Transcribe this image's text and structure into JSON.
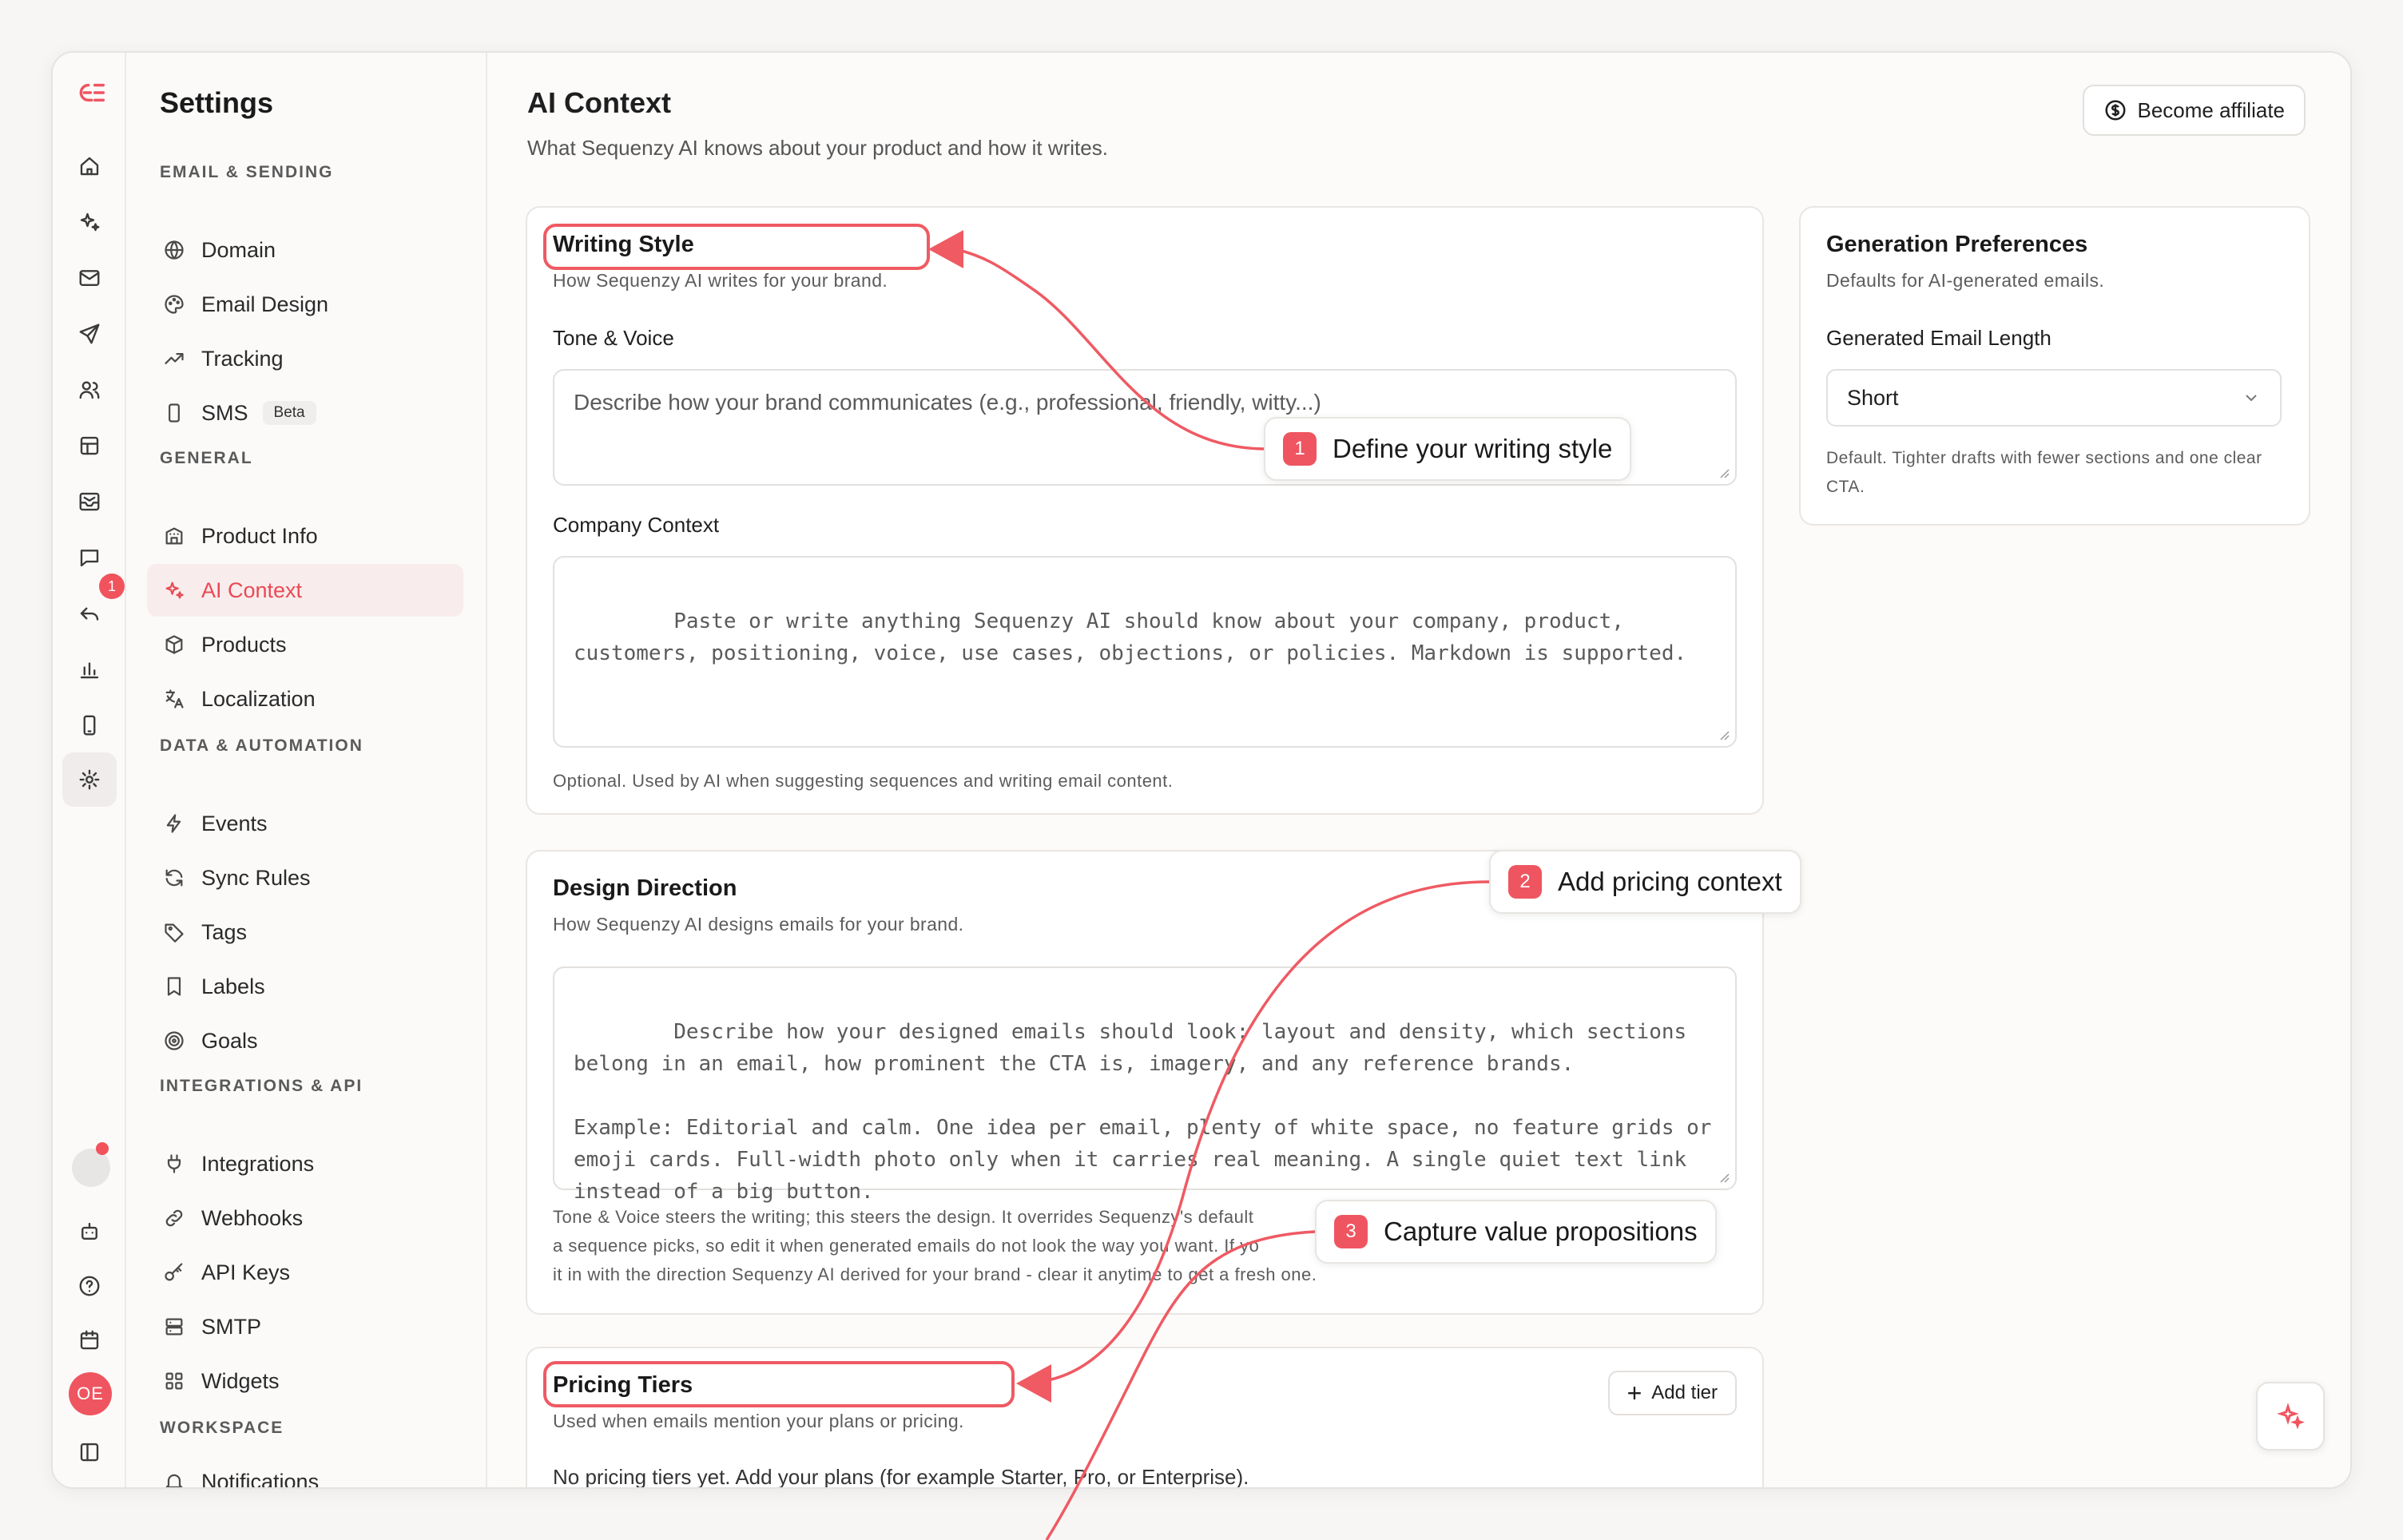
{
  "app": {
    "logo_icon": "sequenzy-logo-icon",
    "notification_count": "1",
    "avatar_initials": "OE"
  },
  "settings": {
    "title": "Settings",
    "sections": {
      "email_sending": "EMAIL & SENDING",
      "general": "GENERAL",
      "data_automation": "DATA & AUTOMATION",
      "integrations_api": "INTEGRATIONS & API",
      "workspace": "WORKSPACE"
    },
    "items": {
      "domain": "Domain",
      "email_design": "Email Design",
      "tracking": "Tracking",
      "sms": "SMS",
      "sms_badge": "Beta",
      "product_info": "Product Info",
      "ai_context": "AI Context",
      "products": "Products",
      "localization": "Localization",
      "events": "Events",
      "sync_rules": "Sync Rules",
      "tags": "Tags",
      "labels": "Labels",
      "goals": "Goals",
      "integrations": "Integrations",
      "webhooks": "Webhooks",
      "api_keys": "API Keys",
      "smtp": "SMTP",
      "widgets": "Widgets",
      "notifications": "Notifications"
    }
  },
  "page": {
    "title": "AI Context",
    "subtitle": "What Sequenzy AI knows about your product and how it writes.",
    "affiliate_label": "Become affiliate"
  },
  "writing_style": {
    "title": "Writing Style",
    "subtitle": "How Sequenzy AI writes for your brand.",
    "tone_label": "Tone & Voice",
    "tone_placeholder": "Describe how your brand communicates (e.g., professional, friendly, witty...)",
    "company_label": "Company Context",
    "company_placeholder": "Paste or write anything Sequenzy AI should know about your company, product, customers, positioning, voice, use cases, objections, or policies. Markdown is supported.",
    "company_help": "Optional. Used by AI when suggesting sequences and writing email content."
  },
  "design_direction": {
    "title": "Design Direction",
    "subtitle": "How Sequenzy AI designs emails for your brand.",
    "placeholder": "Describe how your designed emails should look: layout and density, which sections belong in an email, how prominent the CTA is, imagery, and any reference brands.\n\nExample: Editorial and calm. One idea per email, plenty of white space, no feature grids or emoji cards. Full-width photo only when it carries real meaning. A single quiet text link instead of a big button.",
    "help_1": "Tone & Voice steers the writing; this steers the design. It overrides Sequenzy's default",
    "help_2": "a sequence picks, so edit it when generated emails do not look the way you want. If yo",
    "help_3": "it in with the direction Sequenzy AI derived for your brand - clear it anytime to get a fresh one."
  },
  "pricing": {
    "title": "Pricing Tiers",
    "subtitle": "Used when emails mention your plans or pricing.",
    "add_label": "Add tier",
    "empty": "No pricing tiers yet. Add your plans (for example Starter, Pro, or Enterprise)."
  },
  "generation": {
    "title": "Generation Preferences",
    "subtitle": "Defaults for AI-generated emails.",
    "length_label": "Generated Email Length",
    "length_value": "Short",
    "length_help": "Default. Tighter drafts with fewer sections and one clear CTA."
  },
  "callouts": {
    "one_num": "1",
    "one": "Define your writing style",
    "two_num": "2",
    "two": "Add pricing context",
    "three_num": "3",
    "three": "Capture value propositions"
  },
  "colors": {
    "accent": "#ef5560",
    "accent_soft": "#f9ecec",
    "border": "#e9e6e3"
  }
}
